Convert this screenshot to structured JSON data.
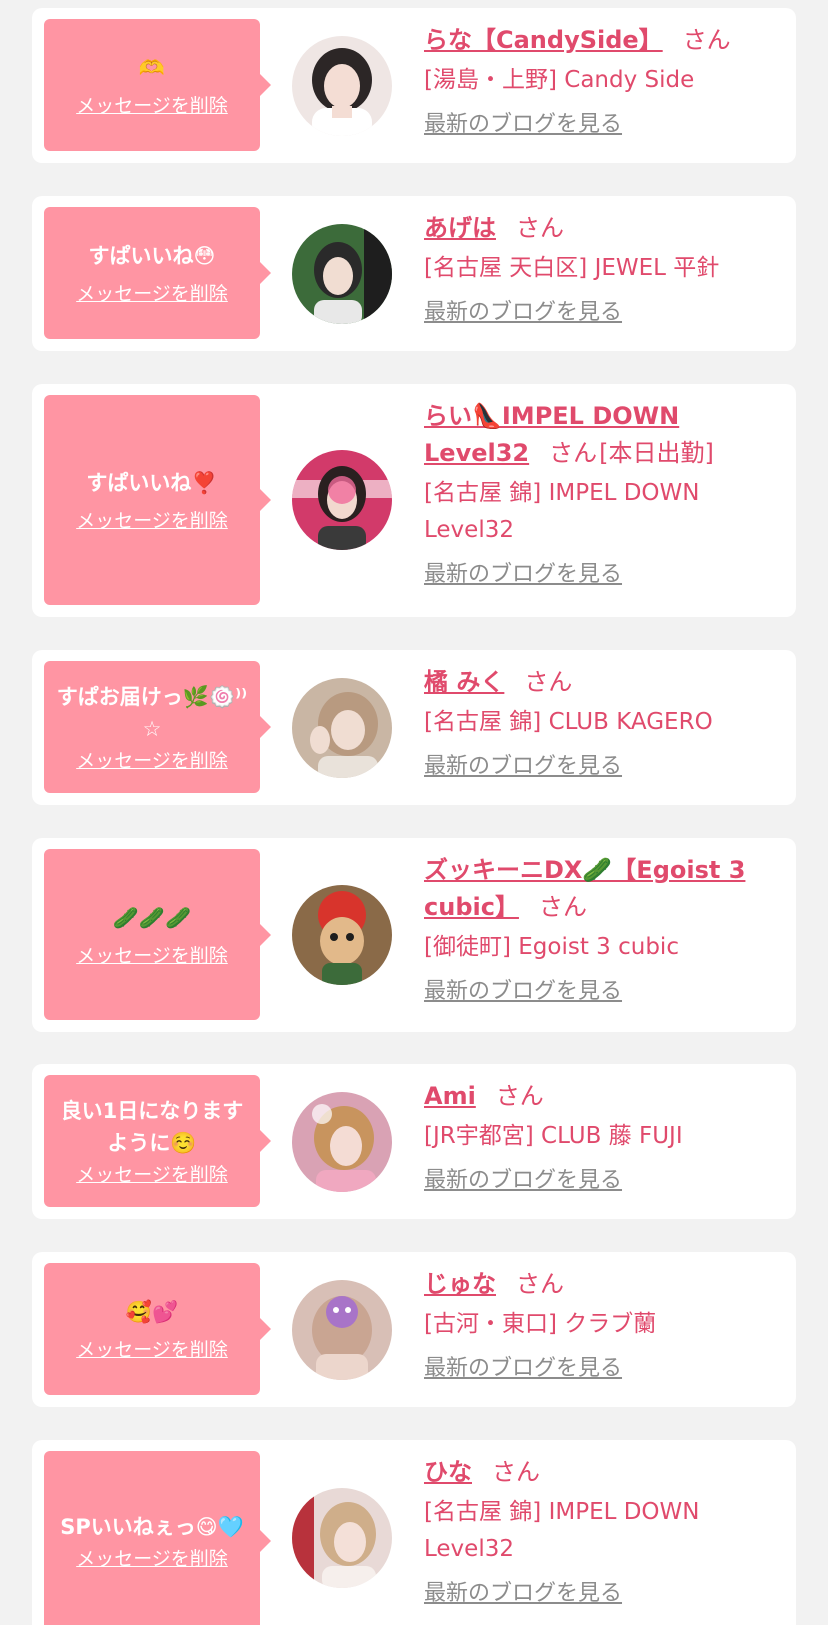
{
  "delete_label": "メッセージを削除",
  "blog_label": "最新のブログを見る",
  "honorific": "さん",
  "colors": {
    "accent": "#e04a6c",
    "bubble": "#ff95a3",
    "background": "#f2f2f2",
    "link_gray": "#8c8c8c"
  },
  "cards": [
    {
      "message": "🫶",
      "name": "らな【CandySide】",
      "shop": "[湯島・上野] Candy Side",
      "extra": "",
      "avatar_icon": "avatar-photo"
    },
    {
      "message": "すぱいいね😳",
      "name": "あげは",
      "shop": "[名古屋 天白区] JEWEL 平針",
      "extra": "",
      "avatar_icon": "avatar-photo"
    },
    {
      "message": "すぱいいね❣️",
      "name": "らい👠IMPEL DOWN Level32",
      "shop": "[名古屋 錦] IMPEL DOWN Level32",
      "extra": "[本日出勤]",
      "avatar_icon": "avatar-photo"
    },
    {
      "message": "すぱお届けっ🌿🍥⁾⁾☆",
      "name": "橘 みく",
      "shop": "[名古屋 錦] CLUB KAGERO",
      "extra": "",
      "avatar_icon": "avatar-photo"
    },
    {
      "message": "🥒🥒🥒",
      "name": "ズッキーニDX🥒【Egoist 3 cubic】",
      "shop": "[御徒町] Egoist 3 cubic",
      "extra": "",
      "avatar_icon": "avatar-photo"
    },
    {
      "message": "良い1日になりますように☺️",
      "name": "Ami",
      "shop": "[JR宇都宮] CLUB 藤 FUJI",
      "extra": "",
      "avatar_icon": "avatar-photo"
    },
    {
      "message": "🥰💕",
      "name": "じゅな",
      "shop": "[古河・東口] クラブ蘭",
      "extra": "",
      "avatar_icon": "avatar-photo"
    },
    {
      "message": "SPいいねぇっ😋🩵",
      "name": "ひな",
      "shop": "[名古屋 錦] IMPEL DOWN Level32",
      "extra": "",
      "avatar_icon": "avatar-photo"
    }
  ]
}
